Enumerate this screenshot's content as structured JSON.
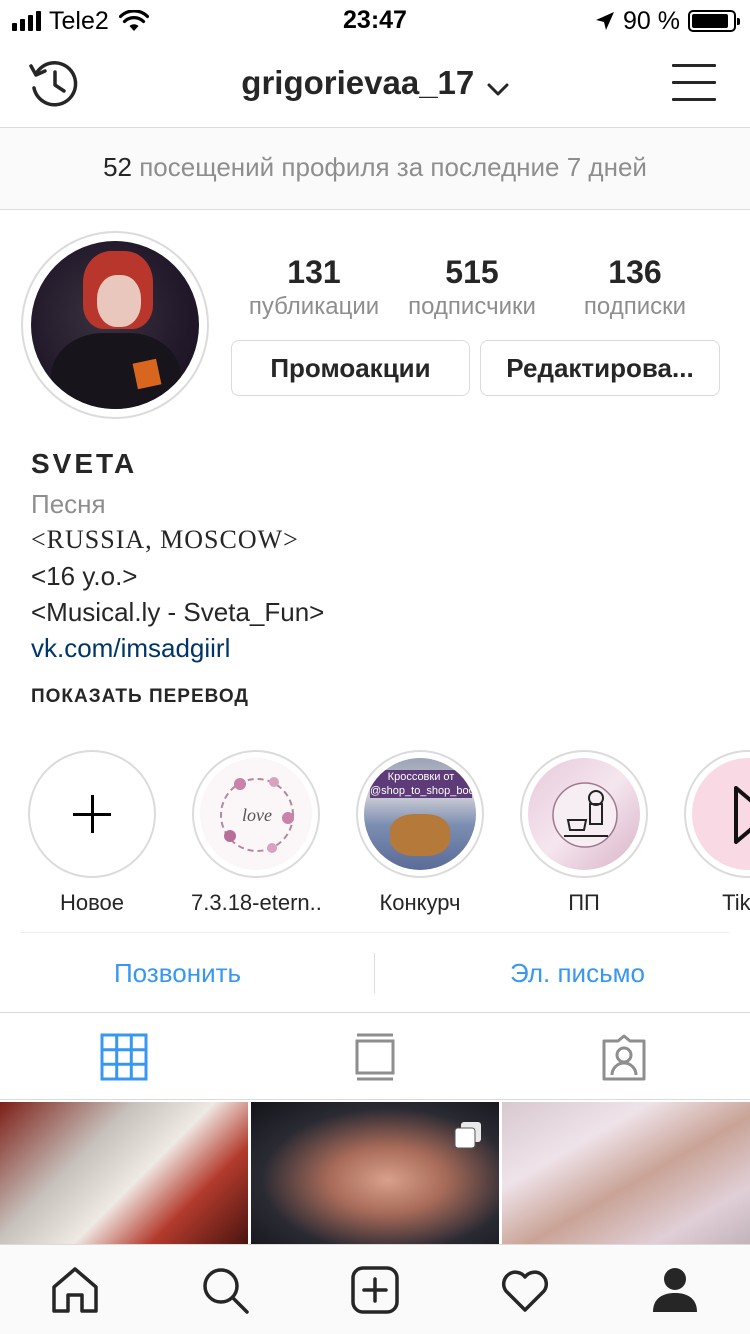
{
  "status_bar": {
    "carrier": "Tele2",
    "time": "23:47",
    "battery_percent": "90 %",
    "battery_level": 0.9
  },
  "header": {
    "username": "grigorievaa_17"
  },
  "visits_banner": {
    "count": "52",
    "text": "посещений профиля за последние 7 дней"
  },
  "profile": {
    "stats": [
      {
        "value": "131",
        "label": "публикации"
      },
      {
        "value": "515",
        "label": "подписчики"
      },
      {
        "value": "136",
        "label": "подписки"
      }
    ],
    "promo_button": "Промоакции",
    "edit_button": "Редактирова..."
  },
  "bio": {
    "name": "SVETA",
    "category": "Песня",
    "lines": [
      "<RUSSIA, MOSCOW>",
      "<16 y.o.>",
      "<Musical.ly - Sveta_Fun>"
    ],
    "link": "vk.com/imsadgiirl",
    "translate": "ПОКАЗАТЬ ПЕРЕВОД"
  },
  "highlights": [
    {
      "label": "Новое",
      "icon": "plus-icon"
    },
    {
      "label": "7.3.18-etern...",
      "cover_text": "love"
    },
    {
      "label": "Конкурч",
      "cover_text": "Кроссовки от @shop_to_shop_boot"
    },
    {
      "label": "ПП",
      "icon": "chef-icon"
    },
    {
      "label": "TikTo",
      "icon": "play-icon"
    }
  ],
  "contact": {
    "call": "Позвонить",
    "email": "Эл. письмо"
  },
  "tabs": {
    "active": "grid",
    "items": [
      "grid-icon",
      "feed-icon",
      "tagged-icon"
    ]
  },
  "bottom_nav": {
    "items": [
      "home-icon",
      "search-icon",
      "new-post-icon",
      "activity-icon",
      "profile-icon"
    ]
  },
  "colors": {
    "link_blue": "#3897f0",
    "bio_link": "#003569",
    "secondary_text": "#8e8e8e",
    "border": "#dbdbdb"
  }
}
